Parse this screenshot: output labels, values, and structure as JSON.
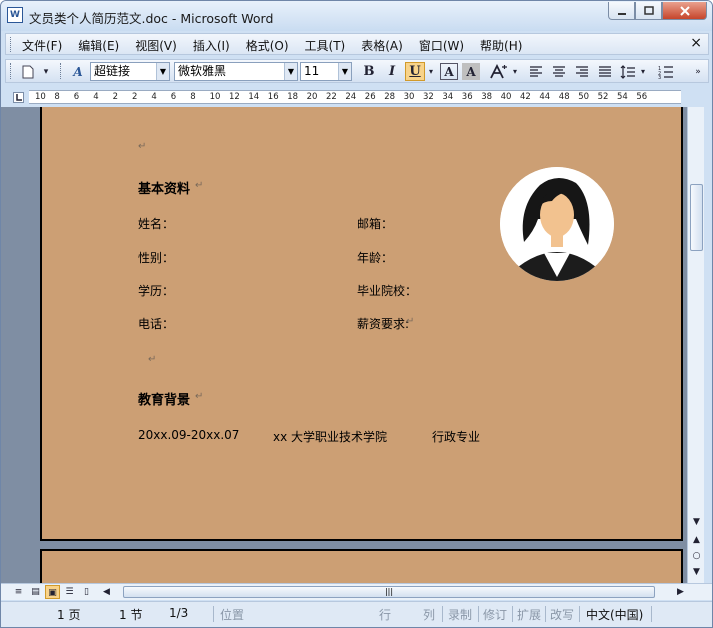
{
  "window": {
    "title": "文员类个人简历范文.doc - Microsoft Word",
    "app_icon": "W"
  },
  "menu": {
    "items": [
      "文件(F)",
      "编辑(E)",
      "视图(V)",
      "插入(I)",
      "格式(O)",
      "工具(T)",
      "表格(A)",
      "窗口(W)",
      "帮助(H)"
    ],
    "close": "×"
  },
  "toolbar": {
    "style": "超链接",
    "font": "微软雅黑",
    "size": "11",
    "bold": "B",
    "italic": "I",
    "underline": "U",
    "font_color_a": "A",
    "char_shade_a": "A"
  },
  "ruler": {
    "labels": [
      "10",
      "8",
      "6",
      "4",
      "2",
      "2",
      "4",
      "6",
      "8",
      "10",
      "12",
      "14",
      "16",
      "18",
      "20",
      "22",
      "24",
      "26",
      "28",
      "30",
      "32",
      "34",
      "36",
      "38",
      "40",
      "42",
      "44",
      "48",
      "50",
      "52",
      "54",
      "56"
    ]
  },
  "document": {
    "section1_title": "基本资料",
    "fields": {
      "name": "姓名：",
      "email": "邮箱：",
      "gender": "性别：",
      "age": "年龄：",
      "education": "学历：",
      "school": "毕业院校：",
      "phone": "电话：",
      "salary": "薪资要求:"
    },
    "section2_title": "教育背景",
    "edu": {
      "period": "20xx.09-20xx.07",
      "school": "xx 大学职业技术学院",
      "major": "行政专业"
    },
    "para_mark": "↵",
    "page_color": "#cc9f74"
  },
  "status": {
    "page": "1 页",
    "section": "1 节",
    "count": "1/3",
    "position": "位置",
    "line": "行",
    "col": "列",
    "rec": "录制",
    "trk": "修订",
    "ext": "扩展",
    "ovr": "改写",
    "lang": "中文(中国)"
  }
}
